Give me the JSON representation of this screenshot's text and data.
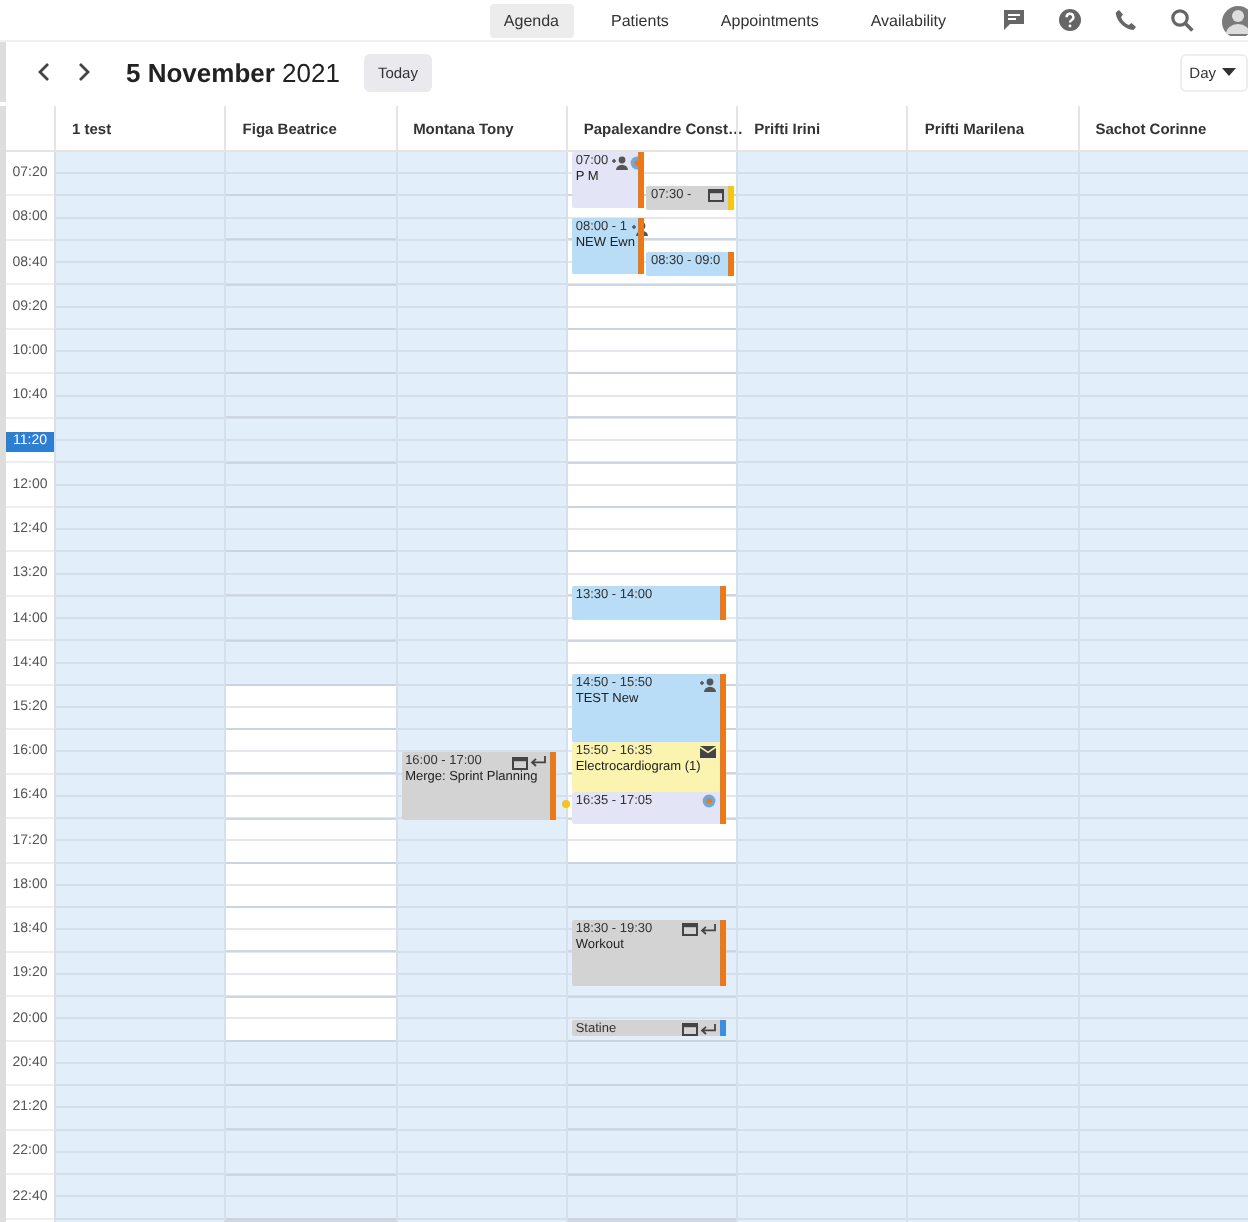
{
  "top_nav": {
    "tabs": [
      {
        "label": "Agenda",
        "selected": true
      },
      {
        "label": "Patients",
        "selected": false
      },
      {
        "label": "Appointments",
        "selected": false
      },
      {
        "label": "Availability",
        "selected": false
      }
    ]
  },
  "toolbar": {
    "date_bold": "5 November",
    "date_rest": "2021",
    "today_button": "Today",
    "view": "Day"
  },
  "time_labels": [
    {
      "label": "07:20",
      "current": false
    },
    {
      "label": "08:00",
      "current": false
    },
    {
      "label": "08:40",
      "current": false
    },
    {
      "label": "09:20",
      "current": false
    },
    {
      "label": "10:00",
      "current": false
    },
    {
      "label": "10:40",
      "current": false
    },
    {
      "label": "11:20",
      "current": true
    },
    {
      "label": "12:00",
      "current": false
    },
    {
      "label": "12:40",
      "current": false
    },
    {
      "label": "13:20",
      "current": false
    },
    {
      "label": "14:00",
      "current": false
    },
    {
      "label": "14:40",
      "current": false
    },
    {
      "label": "15:20",
      "current": false
    },
    {
      "label": "16:00",
      "current": false
    },
    {
      "label": "16:40",
      "current": false
    },
    {
      "label": "17:20",
      "current": false
    },
    {
      "label": "18:00",
      "current": false
    },
    {
      "label": "18:40",
      "current": false
    },
    {
      "label": "19:20",
      "current": false
    },
    {
      "label": "20:00",
      "current": false
    },
    {
      "label": "20:40",
      "current": false
    },
    {
      "label": "21:20",
      "current": false
    },
    {
      "label": "22:00",
      "current": false
    },
    {
      "label": "22:40",
      "current": false
    }
  ],
  "columns": [
    {
      "name": "1 test"
    },
    {
      "name": "Figa Beatrice",
      "available": [
        false,
        false,
        false,
        false,
        false,
        false,
        false,
        false,
        false,
        false,
        false,
        false,
        true,
        true,
        true,
        true,
        true,
        true,
        true,
        true,
        false,
        false,
        false,
        false
      ]
    },
    {
      "name": "Montana Tony",
      "events": [
        {
          "kind": "full",
          "time": "16:00 - 17:00",
          "title": "Merge: Sprint Planning",
          "color": "#d3d3d3",
          "status_bar": {
            "color": "#e8791c"
          },
          "icons": [
            {
              "kind": "calendar"
            },
            {
              "kind": "reply"
            }
          ]
        }
      ]
    },
    {
      "name": "Papalexandre Const…",
      "available": [
        true,
        true,
        true,
        true,
        true,
        true,
        true,
        true,
        true,
        true,
        true,
        true,
        true,
        true,
        true,
        true,
        false,
        false,
        false,
        false,
        false,
        false,
        false,
        false
      ],
      "events": [
        {
          "kind": "left",
          "time": "07:00",
          "title": "P M",
          "color": "#e4e4f7",
          "status_bar": {
            "color": "#e8791c"
          },
          "icons": [
            {
              "kind": "person"
            },
            {
              "kind": "circle"
            }
          ]
        },
        {
          "kind": "right",
          "time": "07:30 -",
          "color": "#d3d3d3",
          "status_bar": {
            "color": "#f5c518"
          },
          "icons": [
            {
              "kind": "calendar"
            }
          ]
        },
        {
          "kind": "left",
          "time": "08:00 - 1",
          "title": "NEW Ewn",
          "color": "#b9dcf7",
          "status_bar": {
            "color": "#e8791c"
          },
          "icons": [
            {
              "kind": "person"
            }
          ]
        },
        {
          "kind": "right",
          "time": "08:30 - 09:0",
          "color": "#b9dcf7",
          "status_bar": {
            "color": "#e8791c"
          }
        },
        {
          "kind": "full",
          "time": "13:30 - 14:00",
          "color": "#b9dcf7",
          "status_bar": {
            "color": "#e8791c"
          }
        },
        {
          "kind": "full",
          "time": "14:50 - 15:50",
          "title": "TEST New",
          "color": "#b9dcf7",
          "status_bar": {
            "color": "#e8791c"
          },
          "icons": [
            {
              "kind": "person"
            }
          ]
        },
        {
          "kind": "full",
          "time": "15:50 - 16:35",
          "title": "Electrocardiogram (1)",
          "color": "#fbf4b0",
          "status_bar": {
            "color": "#e8791c"
          },
          "icons": [
            {
              "kind": "mail"
            }
          ]
        },
        {
          "kind": "full",
          "time": "16:35 - 17:05",
          "color": "#e4e4f7",
          "status_bar": {
            "color": "#e8791c"
          },
          "marker": {
            "color": "#f5c518"
          },
          "icons": [
            {
              "kind": "circle"
            }
          ]
        },
        {
          "kind": "full",
          "time": "18:30 - 19:30",
          "title": "Workout",
          "color": "#d3d3d3",
          "status_bar": {
            "color": "#e8791c"
          },
          "icons": [
            {
              "kind": "calendar"
            },
            {
              "kind": "reply"
            }
          ]
        },
        {
          "kind": "full",
          "title": "Statine",
          "color": "#d3d3d3",
          "status_bar": {
            "color": "#3b8fe0"
          },
          "icons": [
            {
              "kind": "calendar"
            },
            {
              "kind": "reply"
            }
          ]
        }
      ]
    },
    {
      "name": "Prifti Irini"
    },
    {
      "name": "Prifti Marilena"
    },
    {
      "name": "Sachot Corinne"
    }
  ]
}
